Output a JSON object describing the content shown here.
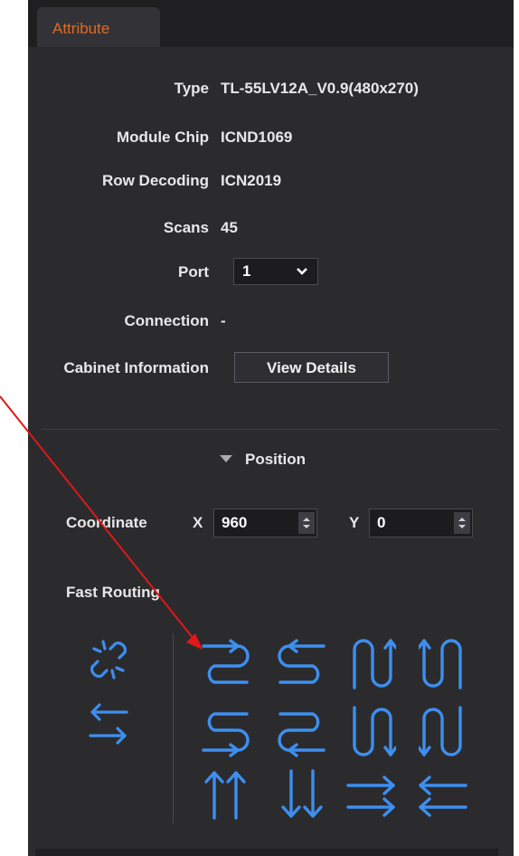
{
  "tab": {
    "label": "Attribute"
  },
  "attributes": {
    "type_label": "Type",
    "type_value": "TL-55LV12A_V0.9(480x270)",
    "module_chip_label": "Module Chip",
    "module_chip_value": "ICND1069",
    "row_decoding_label": "Row Decoding",
    "row_decoding_value": "ICN2019",
    "scans_label": "Scans",
    "scans_value": "45",
    "port_label": "Port",
    "port_value": "1",
    "connection_label": "Connection",
    "connection_value": "-",
    "cabinet_label": "Cabinet Information",
    "view_details_label": "View Details"
  },
  "position": {
    "section_label": "Position",
    "coordinate_label": "Coordinate",
    "x_label": "X",
    "x_value": "960",
    "y_label": "Y",
    "y_value": "0"
  },
  "fast_routing": {
    "label": "Fast Routing"
  },
  "colors": {
    "accent": "#e06a24",
    "icon_blue": "#3d8ff0",
    "annotation_red": "#e01818"
  }
}
